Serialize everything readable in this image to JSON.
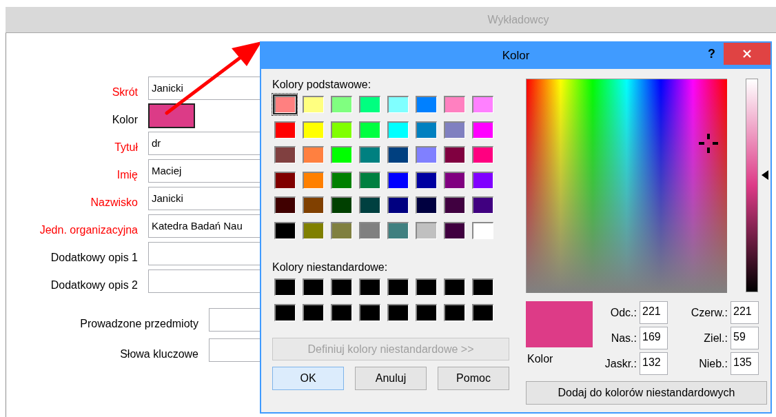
{
  "window": {
    "title": "Wykładowcy"
  },
  "form": {
    "fields": [
      {
        "label": "Skrót",
        "required": true,
        "kind": "text",
        "value": "Janicki"
      },
      {
        "label": "Kolor",
        "required": false,
        "kind": "color",
        "color": "#dc3b87"
      },
      {
        "label": "Tytuł",
        "required": true,
        "kind": "text",
        "value": "dr"
      },
      {
        "label": "Imię",
        "required": true,
        "kind": "text",
        "value": "Maciej"
      },
      {
        "label": "Nazwisko",
        "required": true,
        "kind": "text",
        "value": "Janicki"
      },
      {
        "label": "Jedn. organizacyjna",
        "required": true,
        "kind": "text",
        "value": "Katedra Badań Nau"
      },
      {
        "label": "Dodatkowy opis 1",
        "required": false,
        "kind": "text"
      },
      {
        "label": "Dodatkowy opis 2",
        "required": false,
        "kind": "text"
      }
    ],
    "extra_fields": [
      {
        "label": "Prowadzone przedmioty"
      },
      {
        "label": "Słowa kluczowe"
      }
    ]
  },
  "dialog": {
    "title": "Kolor",
    "help": "?",
    "basic_label": "Kolory podstawowe:",
    "basic_colors": [
      {
        "color": "#ff8080",
        "selected": true
      },
      {
        "color": "#ffff80",
        "selected": false
      },
      {
        "color": "#80ff80",
        "selected": false
      },
      {
        "color": "#00ff80",
        "selected": false
      },
      {
        "color": "#80ffff",
        "selected": false
      },
      {
        "color": "#0080ff",
        "selected": false
      },
      {
        "color": "#ff80c0",
        "selected": false
      },
      {
        "color": "#ff80ff",
        "selected": false
      },
      {
        "color": "#ff0000",
        "selected": false
      },
      {
        "color": "#ffff00",
        "selected": false
      },
      {
        "color": "#80ff00",
        "selected": false
      },
      {
        "color": "#00ff40",
        "selected": false
      },
      {
        "color": "#00ffff",
        "selected": false
      },
      {
        "color": "#0080c0",
        "selected": false
      },
      {
        "color": "#8080c0",
        "selected": false
      },
      {
        "color": "#ff00ff",
        "selected": false
      },
      {
        "color": "#804040",
        "selected": false
      },
      {
        "color": "#ff8040",
        "selected": false
      },
      {
        "color": "#00ff00",
        "selected": false
      },
      {
        "color": "#008080",
        "selected": false
      },
      {
        "color": "#004080",
        "selected": false
      },
      {
        "color": "#8080ff",
        "selected": false
      },
      {
        "color": "#800040",
        "selected": false
      },
      {
        "color": "#ff0080",
        "selected": false
      },
      {
        "color": "#800000",
        "selected": false
      },
      {
        "color": "#ff8000",
        "selected": false
      },
      {
        "color": "#008000",
        "selected": false
      },
      {
        "color": "#008040",
        "selected": false
      },
      {
        "color": "#0000ff",
        "selected": false
      },
      {
        "color": "#0000a0",
        "selected": false
      },
      {
        "color": "#800080",
        "selected": false
      },
      {
        "color": "#8000ff",
        "selected": false
      },
      {
        "color": "#400000",
        "selected": false
      },
      {
        "color": "#804000",
        "selected": false
      },
      {
        "color": "#004000",
        "selected": false
      },
      {
        "color": "#004040",
        "selected": false
      },
      {
        "color": "#000080",
        "selected": false
      },
      {
        "color": "#000040",
        "selected": false
      },
      {
        "color": "#400040",
        "selected": false
      },
      {
        "color": "#400080",
        "selected": false
      },
      {
        "color": "#000000",
        "selected": false
      },
      {
        "color": "#808000",
        "selected": false
      },
      {
        "color": "#808040",
        "selected": false
      },
      {
        "color": "#808080",
        "selected": false
      },
      {
        "color": "#408080",
        "selected": false
      },
      {
        "color": "#c0c0c0",
        "selected": false
      },
      {
        "color": "#400040",
        "selected": false
      },
      {
        "color": "#ffffff",
        "selected": false
      }
    ],
    "custom_label": "Kolory niestandardowe:",
    "custom_colors": [
      {
        "color": "#000000"
      },
      {
        "color": "#000000"
      },
      {
        "color": "#000000"
      },
      {
        "color": "#000000"
      },
      {
        "color": "#000000"
      },
      {
        "color": "#000000"
      },
      {
        "color": "#000000"
      },
      {
        "color": "#000000"
      },
      {
        "color": "#000000"
      },
      {
        "color": "#000000"
      },
      {
        "color": "#000000"
      },
      {
        "color": "#000000"
      },
      {
        "color": "#000000"
      },
      {
        "color": "#000000"
      },
      {
        "color": "#000000"
      },
      {
        "color": "#000000"
      }
    ],
    "define_button": {
      "label": "Definiuj kolory niestandardowe >>",
      "disabled": true
    },
    "buttons": [
      {
        "label": "OK",
        "default": true
      },
      {
        "label": "Anuluj",
        "default": false
      },
      {
        "label": "Pomoc",
        "default": false
      }
    ],
    "luminance": {
      "level": 0.55
    },
    "preview": {
      "color": "#dd3b87",
      "label": "Kolor"
    },
    "hsl_fields": [
      {
        "label": "Odc.:",
        "value": "221"
      },
      {
        "label": "Nas.:",
        "value": "169"
      },
      {
        "label": "Jaskr.:",
        "value": "132"
      }
    ],
    "rgb_fields": [
      {
        "label": "Czerw.:",
        "value": "221"
      },
      {
        "label": "Ziel.:",
        "value": "59"
      },
      {
        "label": "Nieb.:",
        "value": "135"
      }
    ],
    "add_button": {
      "label": "Dodaj do kolorów niestandardowych"
    }
  }
}
